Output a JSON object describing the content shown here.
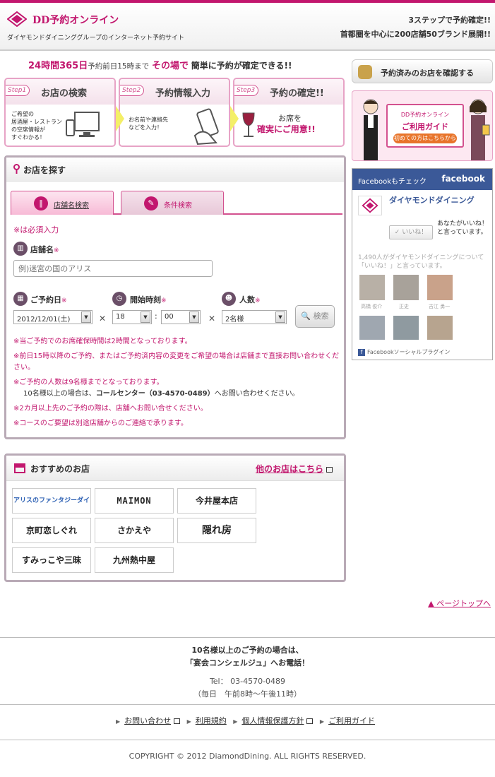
{
  "header": {
    "brand": "DD予約オンライン",
    "subtitle": "ダイヤモンドダイニンググループのインターネット予約サイト",
    "tagline1": "3ステップで予約確定!!",
    "tagline2": "首都圏を中心に200店舗50ブランド展開!!"
  },
  "headline": {
    "part1": "24時間365日",
    "part2": "予約前日15時まで",
    "part3": "その場で",
    "part4": "簡単に予約が確定できる!!"
  },
  "steps": [
    {
      "tag": "Step1",
      "title": "お店の検索",
      "desc": "ご希望の\n居酒屋・レストラン\nの空席情報が\nすぐわかる！"
    },
    {
      "tag": "Step2",
      "title": "予約情報入力",
      "desc": "お名前や連絡先\nなどを入力！"
    },
    {
      "tag": "Step3",
      "title": "予約の確定!!",
      "desc1": "お席を",
      "desc2": "確実にご用意!!"
    }
  ],
  "search": {
    "title": "お店を探す",
    "tab_name": "店舗名検索",
    "tab_condition": "条件検索",
    "required_note": "※は必須入力",
    "shop_label": "店舗名",
    "shop_placeholder": "例)迷宮の国のアリス",
    "date_label": "ご予約日",
    "time_label": "開始時刻",
    "people_label": "人数",
    "asterisk": "※",
    "date_value": "2012/12/01(土)",
    "hour_value": "18",
    "minute_value": "00",
    "people_value": "2名様",
    "search_button": "検索",
    "notes": [
      "※当ご予約でのお席確保時間は2時間となっております。",
      "※前日15時以降のご予約、またはご予約済内容の変更をご希望の場合は店舗まで直接お問い合わせください。",
      "※ご予約の人数は9名様までとなっております。",
      "10名様以上の場合は、",
      "コールセンター（03-4570-0489）",
      "へお問い合わせください。",
      "※2カ月以上先のご予約の際は、店舗へお問い合せください。",
      "※コースのご要望は別途店舗からのご連絡で承ります。"
    ]
  },
  "recommend": {
    "title": "おすすめのお店",
    "more_link": "他のお店はこちら",
    "brands": [
      "アリスのファンタジーダイニング",
      "MAIMON",
      "今井屋本店",
      "京町恋しぐれ",
      "さかえや",
      "隠れ房",
      "すみっこや三昧",
      "九州熱中屋"
    ]
  },
  "sidebar": {
    "confirm_button": "予約済みのお店を確認する",
    "guide_top": "DD予約オンライン",
    "guide_title": "ご利用ガイド",
    "guide_button": "初めての方はこちらから",
    "fb_header": "Facebookもチェック",
    "fb_logo": "facebook",
    "fb_page_name": "ダイヤモンドダイニング",
    "fb_like": "いいね！",
    "fb_like_info": "あなたがいいね！と言っています。",
    "fb_count": "1,490人がダイヤモンドダイニングについて「いいね！」と言っています。",
    "fb_names": [
      "高橋 俊介",
      "正史",
      "吉江 勇一"
    ],
    "fb_plugin": "Facebookソーシャルプラグイン"
  },
  "page_top": "▲ ページトップへ",
  "footer": {
    "msg1": "10名様以上のご予約の場合は、",
    "msg2": "「宴会コンシェルジュ」へお電話！",
    "tel": "Tel： 03-4570-0489",
    "hours": "（毎日　午前8時～午後11時）",
    "links": [
      "お問い合わせ",
      "利用規約",
      "個人情報保護方針",
      "ご利用ガイド"
    ],
    "copyright": "COPYRIGHT © 2012 DiamondDining. ALL RIGHTS RESERVED."
  },
  "colors": {
    "accent": "#c2176e",
    "fb_blue": "#3b5998",
    "box_border": "#b9aab6"
  }
}
